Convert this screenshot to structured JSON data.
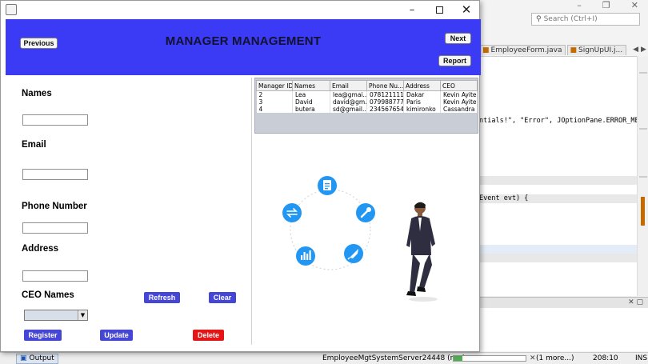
{
  "ide": {
    "search_placeholder": "Search (Ctrl+I)",
    "tabs": [
      {
        "label": "EmployeeForm.java"
      },
      {
        "label": "SignUpUI.j..."
      }
    ],
    "code_lines": [
      {
        "text": "ntials!\", \"Error\", JOptionPane.ERROR_MES",
        "highlight": false
      },
      {
        "text": "",
        "highlight": true
      },
      {
        "text": "Event evt) {",
        "highlight": true
      },
      {
        "text": "",
        "highlight": true
      },
      {
        "text": "",
        "highlight": true
      }
    ],
    "status": {
      "output_tab": "Output",
      "server": "EmployeeMgtSystemServer24448 (run)",
      "more": "(1 more...)",
      "position": "208:10",
      "mode": "INS",
      "progress": 0.12
    }
  },
  "app": {
    "header": {
      "title": "MANAGER MANAGEMENT",
      "previous": "Previous",
      "next": "Next",
      "report": "Report"
    },
    "form": {
      "names_label": "Names",
      "names_value": "",
      "email_label": "Email",
      "email_value": "",
      "phone_label": "Phone Number",
      "phone_value": "",
      "address_label": "Address",
      "address_value": "",
      "ceo_label": "CEO Names",
      "ceo_selected": "",
      "refresh": "Refresh",
      "clear": "Clear",
      "register": "Register",
      "update": "Update",
      "delete": "Delete"
    },
    "table": {
      "columns": [
        "Manager ID",
        "Names",
        "Email",
        "Phone Nu...",
        "Address",
        "CEO"
      ],
      "rows": [
        [
          "2",
          "Lea",
          "lea@gmai...",
          "078121111...",
          "Dakar",
          "Kevin Ayite"
        ],
        [
          "3",
          "David",
          "david@gm...",
          "079988777...",
          "Paris",
          "Kevin Ayite"
        ],
        [
          "4",
          "butera",
          "sd@gmail...",
          "234567654...",
          "kimironko",
          "Cassandra"
        ]
      ]
    }
  },
  "colors": {
    "header_bg": "#3b3bf6",
    "action_button": "#4545d6",
    "delete_button": "#e51515",
    "illustration_blue": "#2196f3"
  },
  "icons": [
    "document-icon",
    "wrench-icon",
    "rocket-icon",
    "bar-chart-icon",
    "sync-icon"
  ]
}
